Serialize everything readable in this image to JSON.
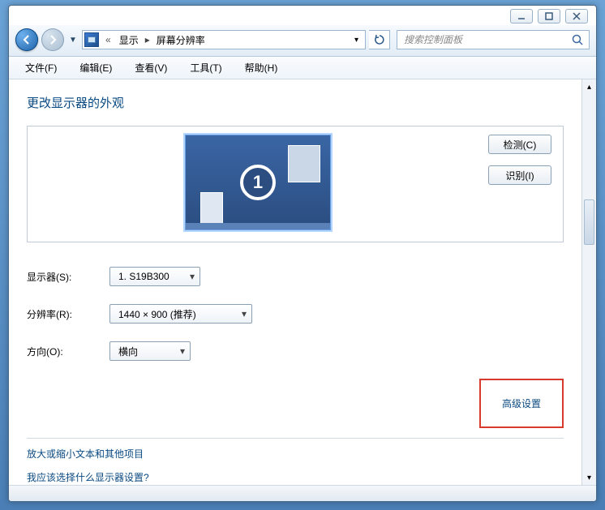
{
  "breadcrumb": {
    "root_label": "显示",
    "current_label": "屏幕分辨率"
  },
  "search": {
    "placeholder": "搜索控制面板"
  },
  "menubar": {
    "file": "文件(F)",
    "edit": "编辑(E)",
    "view": "查看(V)",
    "tools": "工具(T)",
    "help": "帮助(H)"
  },
  "page": {
    "title": "更改显示器的外观",
    "detect_btn": "检测(C)",
    "identify_btn": "识别(I)",
    "monitor_number": "1"
  },
  "form": {
    "display_label": "显示器(S):",
    "display_value": "1. S19B300",
    "resolution_label": "分辨率(R):",
    "resolution_value": "1440 × 900 (推荐)",
    "orient_label": "方向(O):",
    "orient_value": "横向"
  },
  "links": {
    "advanced": "高级设置",
    "zoom_text": "放大或缩小文本和其他项目",
    "which": "我应该选择什么显示器设置?"
  }
}
